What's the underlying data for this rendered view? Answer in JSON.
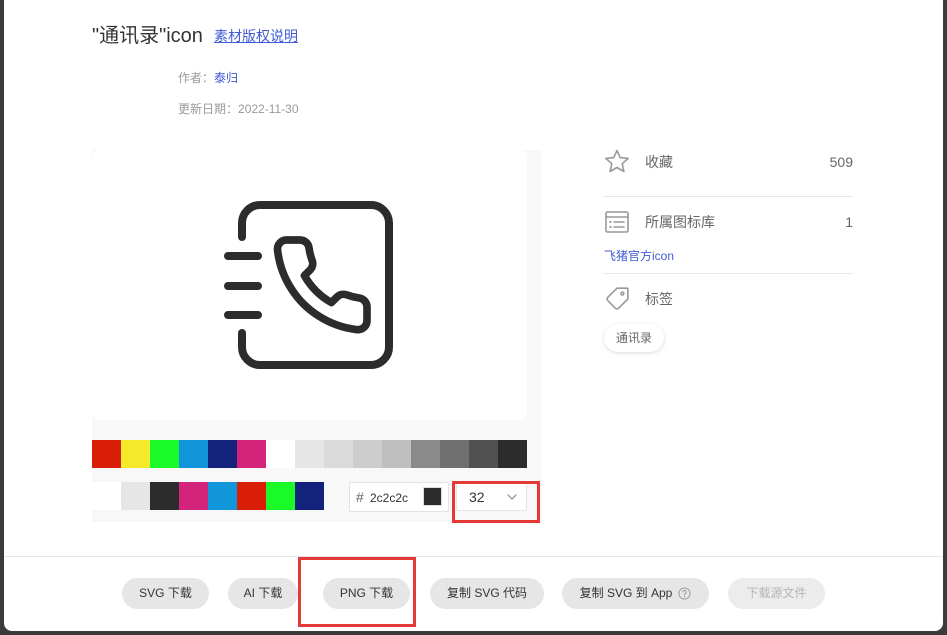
{
  "header": {
    "title": "\"通讯录\"icon",
    "copyright_link": "素材版权说明",
    "author_label": "作者：",
    "author_name": "泰归",
    "date_label": "更新日期：",
    "date_value": "2022-11-30"
  },
  "preview": {
    "icon": "address-book-icon",
    "icon_color": "#2c2c2c"
  },
  "palette": {
    "row1": [
      "#d81e06",
      "#f4ea2a",
      "#1afa29",
      "#1296db",
      "#13227a",
      "#d4237a",
      "#ffffff",
      "#e6e6e6",
      "#dbdbdb",
      "#cdcdcd",
      "#bfbfbf",
      "#8a8a8a",
      "#707070",
      "#515151",
      "#2c2c2c"
    ],
    "row2": [
      "#ffffff",
      "#e6e6e6",
      "#2c2c2c",
      "#d4237a",
      "#1296db",
      "#d81e06",
      "#1afa29",
      "#13227a"
    ]
  },
  "color_input": {
    "prefix": "#",
    "value": "2c2c2c",
    "swatch": "#2c2c2c"
  },
  "size_select": {
    "value": "32",
    "icon": "chevron-down-icon"
  },
  "sidebar": {
    "favorite": {
      "icon": "star-icon",
      "label": "收藏",
      "count": "509"
    },
    "library": {
      "icon": "list-icon",
      "label": "所属图标库",
      "count": "1",
      "link": "飞猪官方icon"
    },
    "tags": {
      "icon": "tag-icon",
      "label": "标签",
      "items": [
        "通讯录"
      ]
    }
  },
  "footer": {
    "buttons": [
      {
        "label": "SVG 下载",
        "disabled": false
      },
      {
        "label": "AI 下载",
        "disabled": false
      },
      {
        "label": "PNG 下载",
        "disabled": false
      },
      {
        "label": "复制 SVG 代码",
        "disabled": false
      },
      {
        "label": "复制 SVG 到 App",
        "icon": "help-circle-icon",
        "disabled": false
      },
      {
        "label": "下载源文件",
        "disabled": true
      }
    ]
  },
  "colors": {
    "link": "#3f5bd5",
    "highlight": "#e53935",
    "overlay": "#3b3b3b",
    "button_bg": "#e6e6e6"
  }
}
